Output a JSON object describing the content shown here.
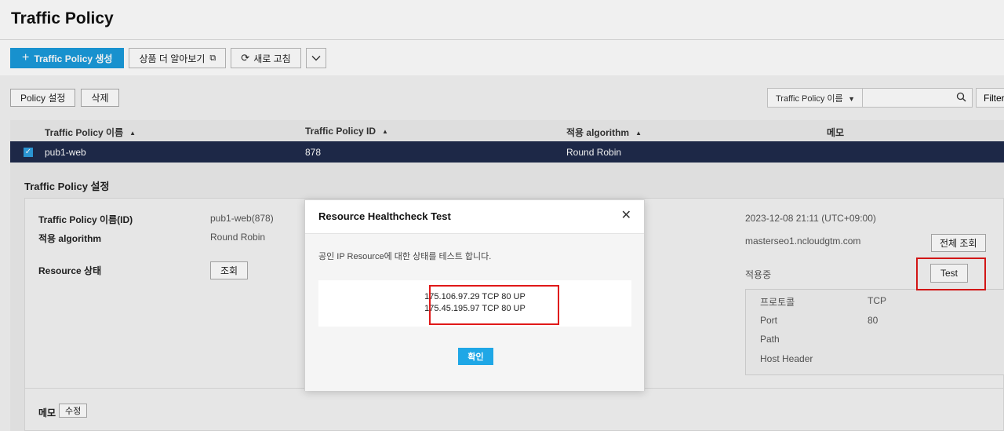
{
  "page": {
    "title": "Traffic Policy"
  },
  "toolbar": {
    "create_label": "Traffic Policy 생성",
    "learn_more_label": "상품 더 알아보기",
    "refresh_label": "새로 고침"
  },
  "actions": {
    "policy_settings": "Policy 설정",
    "delete": "삭제"
  },
  "search": {
    "field_select": "Traffic Policy 이름",
    "value": "",
    "filter_label": "Filter"
  },
  "table": {
    "headers": [
      "Traffic Policy 이름",
      "Traffic Policy ID",
      "적용 algorithm",
      "메모"
    ],
    "rows": [
      {
        "name": "pub1-web",
        "id": "878",
        "algorithm": "Round Robin",
        "memo": "",
        "selected": true
      }
    ]
  },
  "detail": {
    "title": "Traffic Policy 설정",
    "name_label": "Traffic Policy 이름(ID)",
    "name_value": "pub1-web(878)",
    "algorithm_label": "적용 algorithm",
    "algorithm_value": "Round Robin",
    "resource_label": "Resource 상태",
    "lookup_button": "조회",
    "created_at": "2023-12-08 21:11 (UTC+09:00)",
    "domain": "masterseo1.ncloudgtm.com",
    "full_lookup_button": "전체 조회",
    "status": "적용중",
    "test_button": "Test",
    "health": {
      "protocol_label": "프로토콜",
      "protocol_value": "TCP",
      "port_label": "Port",
      "port_value": "80",
      "path_label": "Path",
      "path_value": "",
      "host_header_label": "Host Header",
      "host_header_value": ""
    },
    "memo_label": "메모",
    "memo_edit_button": "수정"
  },
  "modal": {
    "title": "Resource Healthcheck Test",
    "description": "공인 IP Resource에 대한 상태를 테스트 합니다.",
    "results": [
      "175.106.97.29 TCP 80 UP",
      "175.45.195.97 TCP 80 UP"
    ],
    "confirm_label": "확인"
  },
  "colors": {
    "primary": "#1a9bdb",
    "selected_row": "#1f2b4c",
    "highlight": "#e01818",
    "confirm": "#1fa7e6"
  },
  "icons": [
    "plus-icon",
    "external-link-icon",
    "refresh-icon",
    "chevron-down-icon",
    "search-icon",
    "checkbox-checked-icon",
    "sort-icon",
    "close-icon"
  ]
}
